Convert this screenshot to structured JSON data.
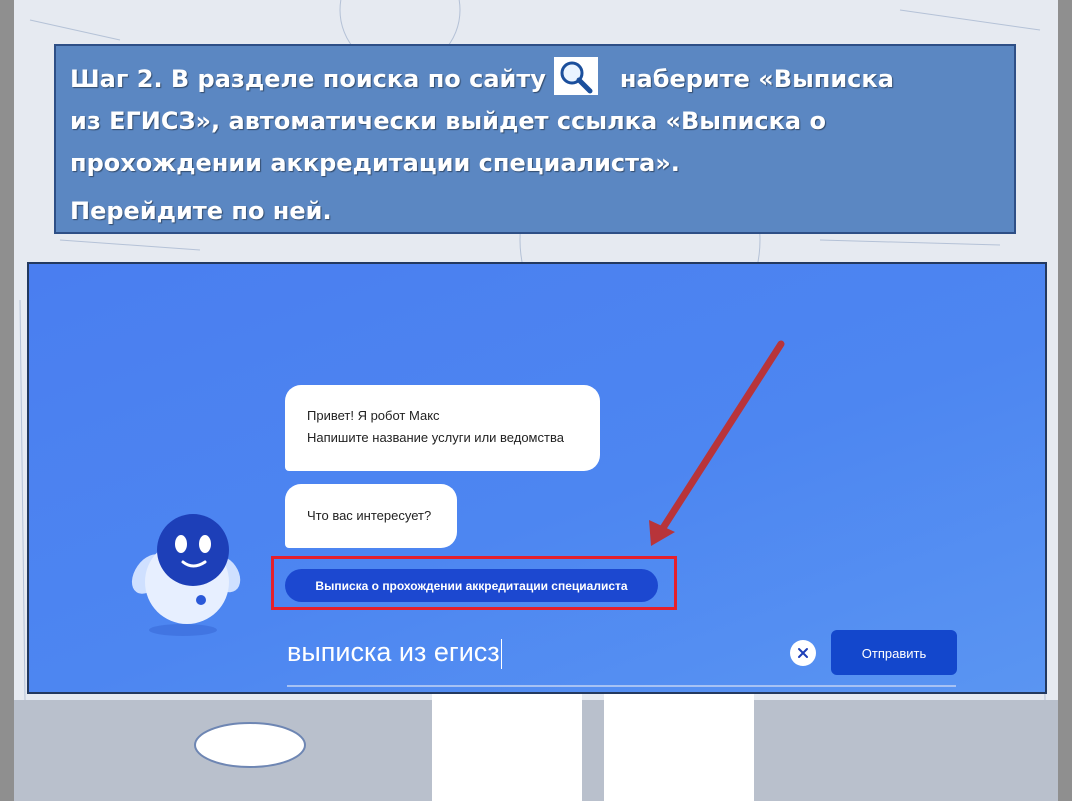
{
  "instruction": {
    "line1_before": "Шаг 2. В разделе поиска по сайту",
    "line1_after": "наберите «Выписка",
    "line2": "из ЕГИСЗ», автоматически выйдет ссылка «Выписка о",
    "line3": "прохождении аккредитации специалиста».",
    "line4": "Перейдите по ней.",
    "icon": "magnifier-icon"
  },
  "chat": {
    "greeting_line1": "Привет! Я робот Макс",
    "greeting_line2": "Напишите название услуги или ведомства",
    "question": "Что вас интересует?",
    "suggestion": "Выписка о прохождении аккредитации специалиста"
  },
  "search": {
    "value": "выписка из егисз",
    "submit_label": "Отправить"
  },
  "colors": {
    "panel": "#5b87c2",
    "screen": "#4d86f1",
    "button": "#1347cc",
    "highlight": "#e5202b",
    "arrow": "#b8343a"
  }
}
